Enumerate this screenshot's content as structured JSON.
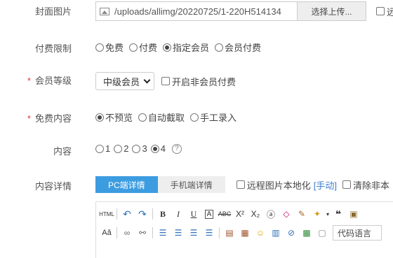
{
  "cover": {
    "label": "封面图片",
    "path": "/uploads/allimg/20220725/1-220H514134",
    "upload_button": "选择上传..."
  },
  "pay_limit": {
    "label": "付费限制",
    "options": [
      "免费",
      "付费",
      "指定会员",
      "会员付费"
    ],
    "selected": "指定会员"
  },
  "member_level": {
    "label": "会员等级",
    "selected": "中级会员",
    "checkbox_label": "开启非会员付费"
  },
  "free_content": {
    "label": "免费内容",
    "options": [
      "不预览",
      "自动截取",
      "手工录入"
    ],
    "selected": "不预览"
  },
  "content": {
    "label": "内容",
    "options": [
      "1",
      "2",
      "3",
      "4"
    ],
    "selected": "4",
    "help": "?"
  },
  "content_detail": {
    "label": "内容详情",
    "tabs": [
      "PC端详情",
      "手机端详情"
    ],
    "remote_label": "远程图片本地化",
    "remote_link": "[手动]",
    "clear_label": "清除非本"
  },
  "editor": {
    "code_language": "代码语言",
    "html_label": "HTML"
  },
  "colors": {
    "accent": "#3c9ce0",
    "required": "#e4393c"
  }
}
